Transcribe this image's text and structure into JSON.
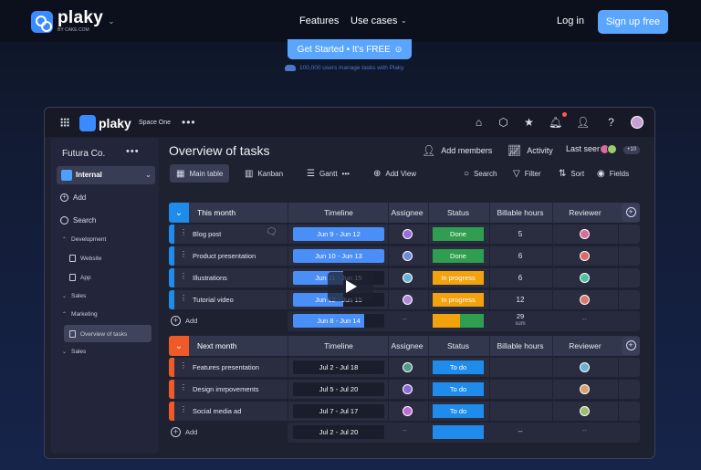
{
  "nav": {
    "logo": "plaky",
    "logo_by": "BY CAKE.COM",
    "features": "Features",
    "use_cases": "Use cases",
    "login": "Log in",
    "signup": "Sign up free",
    "get_started": "Get Started • It's FREE",
    "users_note": "100,000 users manage tasks with Plaky"
  },
  "app": {
    "logo": "plaky",
    "space": "Space One",
    "sidebar": {
      "workspace": "Futura Co.",
      "board": "Internal",
      "add": "Add",
      "search": "Search",
      "development": "Development",
      "website": "Website",
      "app": "App",
      "sales1": "Sales",
      "marketing": "Marketing",
      "overview": "Overview of tasks",
      "sales2": "Sales"
    },
    "title": "Overview of tasks",
    "actions": {
      "add_members": "Add members",
      "activity": "Activity",
      "last_seen": "Last seen",
      "seen_count": "+10"
    },
    "views": {
      "main_table": "Main table",
      "kanban": "Kanban",
      "gantt": "Gantt",
      "add_view": "Add View",
      "search": "Search",
      "filter": "Filter",
      "sort": "Sort",
      "fields": "Fields"
    },
    "columns": {
      "timeline": "Timeline",
      "assignee": "Assignee",
      "status": "Status",
      "billable": "Billable hours",
      "reviewer": "Reviewer"
    },
    "groups": [
      {
        "name": "This month",
        "color": "#1f8ceb",
        "rows": [
          {
            "name": "Blog post",
            "timeline": "Jun 9 - Jun 12",
            "fill": 1.0,
            "status": "Done",
            "status_color": "#2f9e4f",
            "hours": "5",
            "assignee_color": "#9a6cd8",
            "reviewer_color": "#d86c9a"
          },
          {
            "name": "Product presentation",
            "timeline": "Jun 10 - Jun 13",
            "fill": 1.0,
            "status": "Done",
            "status_color": "#2f9e4f",
            "hours": "6",
            "assignee_color": "#6c8ad8",
            "reviewer_color": "#d86c6c"
          },
          {
            "name": "Illustrations",
            "timeline": "Jun 11 - Jun 15",
            "fill": 0.55,
            "status": "In progress",
            "status_color": "#f2a20c",
            "hours": "6",
            "assignee_color": "#6cb0d8",
            "reviewer_color": "#4fc0a0"
          },
          {
            "name": "Tutorial video",
            "timeline": "Jun 12 - Jun 15",
            "fill": 0.55,
            "status": "In progress",
            "status_color": "#f2a20c",
            "hours": "12",
            "assignee_color": "#b08ad8",
            "reviewer_color": "#d87a6c"
          }
        ],
        "add": "Add",
        "summary_timeline": "Jun 8 - Jun 14",
        "summary_fill": 0.78,
        "summary_hours": "29",
        "summary_sum": "sum",
        "summary_dash": "--"
      },
      {
        "name": "Next month",
        "color": "#f05a28",
        "rows": [
          {
            "name": "Features presentation",
            "timeline": "Jul 2 - Jul 18",
            "fill": 0,
            "status": "To do",
            "status_color": "#1f8ceb",
            "hours": "",
            "assignee_color": "#4f9a8a",
            "reviewer_color": "#6cb0d8"
          },
          {
            "name": "Design imrpovements",
            "timeline": "Jul 5 - Jul 20",
            "fill": 0,
            "status": "To do",
            "status_color": "#1f8ceb",
            "hours": "",
            "assignee_color": "#8a6cd8",
            "reviewer_color": "#d8a06c"
          },
          {
            "name": "Social media ad",
            "timeline": "Jul 7 - Jul 17",
            "fill": 0,
            "status": "To do",
            "status_color": "#1f8ceb",
            "hours": "",
            "assignee_color": "#c06cd8",
            "reviewer_color": "#9ac06c"
          }
        ],
        "add": "Add",
        "summary_timeline": "Jul 2 - Jul 20",
        "summary_fill": 0,
        "summary_hours": "--",
        "summary_sum": "",
        "summary_dash": "--"
      }
    ]
  }
}
